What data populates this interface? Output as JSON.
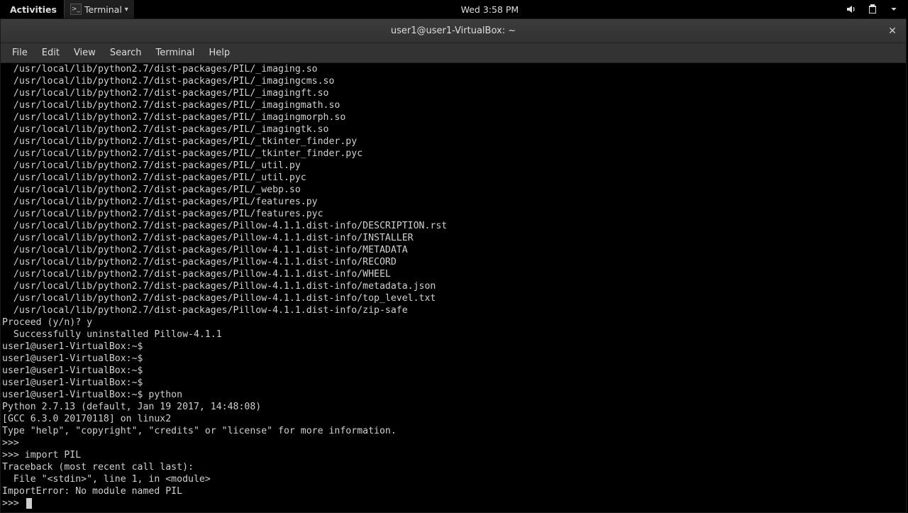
{
  "panel": {
    "activities": "Activities",
    "app_label": "Terminal",
    "clock": "Wed  3:58 PM"
  },
  "window": {
    "title": "user1@user1-VirtualBox: ~"
  },
  "menubar": [
    "File",
    "Edit",
    "View",
    "Search",
    "Terminal",
    "Help"
  ],
  "terminal_lines": [
    "  /usr/local/lib/python2.7/dist-packages/PIL/_imaging.so",
    "  /usr/local/lib/python2.7/dist-packages/PIL/_imagingcms.so",
    "  /usr/local/lib/python2.7/dist-packages/PIL/_imagingft.so",
    "  /usr/local/lib/python2.7/dist-packages/PIL/_imagingmath.so",
    "  /usr/local/lib/python2.7/dist-packages/PIL/_imagingmorph.so",
    "  /usr/local/lib/python2.7/dist-packages/PIL/_imagingtk.so",
    "  /usr/local/lib/python2.7/dist-packages/PIL/_tkinter_finder.py",
    "  /usr/local/lib/python2.7/dist-packages/PIL/_tkinter_finder.pyc",
    "  /usr/local/lib/python2.7/dist-packages/PIL/_util.py",
    "  /usr/local/lib/python2.7/dist-packages/PIL/_util.pyc",
    "  /usr/local/lib/python2.7/dist-packages/PIL/_webp.so",
    "  /usr/local/lib/python2.7/dist-packages/PIL/features.py",
    "  /usr/local/lib/python2.7/dist-packages/PIL/features.pyc",
    "  /usr/local/lib/python2.7/dist-packages/Pillow-4.1.1.dist-info/DESCRIPTION.rst",
    "  /usr/local/lib/python2.7/dist-packages/Pillow-4.1.1.dist-info/INSTALLER",
    "  /usr/local/lib/python2.7/dist-packages/Pillow-4.1.1.dist-info/METADATA",
    "  /usr/local/lib/python2.7/dist-packages/Pillow-4.1.1.dist-info/RECORD",
    "  /usr/local/lib/python2.7/dist-packages/Pillow-4.1.1.dist-info/WHEEL",
    "  /usr/local/lib/python2.7/dist-packages/Pillow-4.1.1.dist-info/metadata.json",
    "  /usr/local/lib/python2.7/dist-packages/Pillow-4.1.1.dist-info/top_level.txt",
    "  /usr/local/lib/python2.7/dist-packages/Pillow-4.1.1.dist-info/zip-safe",
    "Proceed (y/n)? y",
    "  Successfully uninstalled Pillow-4.1.1",
    "user1@user1-VirtualBox:~$ ",
    "user1@user1-VirtualBox:~$ ",
    "user1@user1-VirtualBox:~$ ",
    "user1@user1-VirtualBox:~$ ",
    "user1@user1-VirtualBox:~$ python",
    "Python 2.7.13 (default, Jan 19 2017, 14:48:08) ",
    "[GCC 6.3.0 20170118] on linux2",
    "Type \"help\", \"copyright\", \"credits\" or \"license\" for more information.",
    ">>> ",
    ">>> import PIL",
    "Traceback (most recent call last):",
    "  File \"<stdin>\", line 1, in <module>",
    "ImportError: No module named PIL",
    ">>> "
  ]
}
